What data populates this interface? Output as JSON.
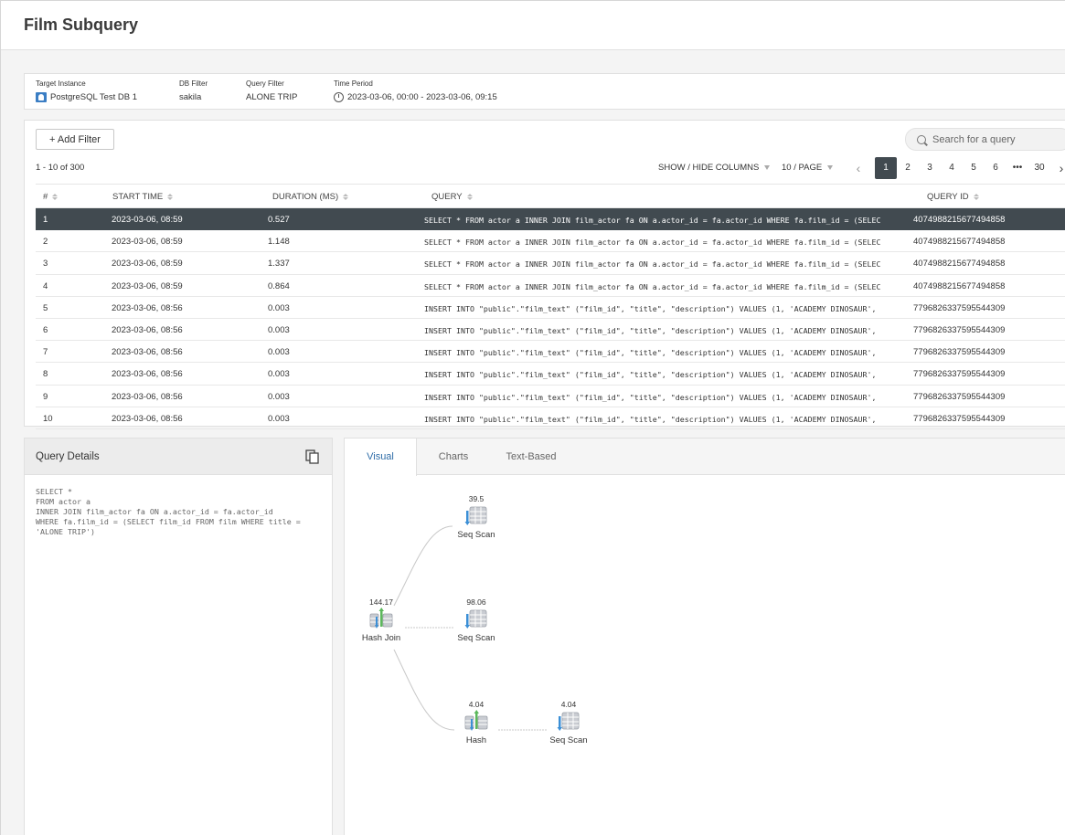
{
  "header": {
    "title": "Film Subquery"
  },
  "filters": [
    {
      "label": "Target Instance",
      "value": "PostgreSQL Test DB 1",
      "icon": "database-icon"
    },
    {
      "label": "DB Filter",
      "value": "sakila"
    },
    {
      "label": "Query Filter",
      "value": "ALONE TRIP"
    },
    {
      "label": "Time Period",
      "value": "2023-03-06, 00:00 - 2023-03-06, 09:15",
      "icon": "clock-icon"
    }
  ],
  "toolbar": {
    "add_filter_label": "+ Add Filter",
    "search_placeholder": "Search for a query",
    "count_text": "1 - 10 of 300",
    "show_hide_label": "SHOW / HIDE COLUMNS",
    "per_page_label": "10 / PAGE"
  },
  "pagination": {
    "prev": "‹",
    "pages": [
      "1",
      "2",
      "3",
      "4",
      "5",
      "6",
      "•••",
      "30"
    ],
    "active": "1",
    "next": "›"
  },
  "table": {
    "columns": [
      "#",
      "START TIME",
      "DURATION (MS)",
      "QUERY",
      "QUERY ID"
    ],
    "rows": [
      [
        "1",
        "2023-03-06, 08:59",
        "0.527",
        "SELECT * FROM actor a INNER JOIN film_actor fa ON a.actor_id = fa.actor_id WHERE fa.film_id = (SELEC",
        "4074988215677494858"
      ],
      [
        "2",
        "2023-03-06, 08:59",
        "1.148",
        "SELECT * FROM actor a INNER JOIN film_actor fa ON a.actor_id = fa.actor_id WHERE fa.film_id = (SELEC",
        "4074988215677494858"
      ],
      [
        "3",
        "2023-03-06, 08:59",
        "1.337",
        "SELECT * FROM actor a INNER JOIN film_actor fa ON a.actor_id = fa.actor_id WHERE fa.film_id = (SELEC",
        "4074988215677494858"
      ],
      [
        "4",
        "2023-03-06, 08:59",
        "0.864",
        "SELECT * FROM actor a INNER JOIN film_actor fa ON a.actor_id = fa.actor_id WHERE fa.film_id = (SELEC",
        "4074988215677494858"
      ],
      [
        "5",
        "2023-03-06, 08:56",
        "0.003",
        "INSERT INTO \"public\".\"film_text\" (\"film_id\", \"title\", \"description\") VALUES (1, 'ACADEMY DINOSAUR',",
        "7796826337595544309"
      ],
      [
        "6",
        "2023-03-06, 08:56",
        "0.003",
        "INSERT INTO \"public\".\"film_text\" (\"film_id\", \"title\", \"description\") VALUES (1, 'ACADEMY DINOSAUR',",
        "7796826337595544309"
      ],
      [
        "7",
        "2023-03-06, 08:56",
        "0.003",
        "INSERT INTO \"public\".\"film_text\" (\"film_id\", \"title\", \"description\") VALUES (1, 'ACADEMY DINOSAUR',",
        "7796826337595544309"
      ],
      [
        "8",
        "2023-03-06, 08:56",
        "0.003",
        "INSERT INTO \"public\".\"film_text\" (\"film_id\", \"title\", \"description\") VALUES (1, 'ACADEMY DINOSAUR',",
        "7796826337595544309"
      ],
      [
        "9",
        "2023-03-06, 08:56",
        "0.003",
        "INSERT INTO \"public\".\"film_text\" (\"film_id\", \"title\", \"description\") VALUES (1, 'ACADEMY DINOSAUR',",
        "7796826337595544309"
      ],
      [
        "10",
        "2023-03-06, 08:56",
        "0.003",
        "INSERT INTO \"public\".\"film_text\" (\"film_id\", \"title\", \"description\") VALUES (1, 'ACADEMY DINOSAUR',",
        "7796826337595544309"
      ]
    ],
    "selected_row": 0
  },
  "details": {
    "title": "Query Details",
    "sql": "SELECT *\nFROM actor a\nINNER JOIN film_actor fa ON a.actor_id = fa.actor_id\nWHERE fa.film_id = (SELECT film_id FROM film WHERE title =\n'ALONE TRIP')"
  },
  "plan": {
    "tabs": [
      "Visual",
      "Charts",
      "Text-Based"
    ],
    "active_tab": "Visual",
    "nodes": [
      {
        "cost": "144.17",
        "label": "Hash Join",
        "icon": "hash-join-icon"
      },
      {
        "cost": "39.5",
        "label": "Seq Scan",
        "icon": "seq-scan-icon"
      },
      {
        "cost": "98.06",
        "label": "Seq Scan",
        "icon": "seq-scan-icon"
      },
      {
        "cost": "4.04",
        "label": "Hash",
        "icon": "hash-icon"
      },
      {
        "cost": "4.04",
        "label": "Seq Scan",
        "icon": "seq-scan-icon"
      }
    ]
  },
  "colors": {
    "selected_row": "#414a50",
    "accent": "#2f6da8",
    "icon_blue": "#3b8fd6",
    "icon_green": "#5cb85c"
  }
}
